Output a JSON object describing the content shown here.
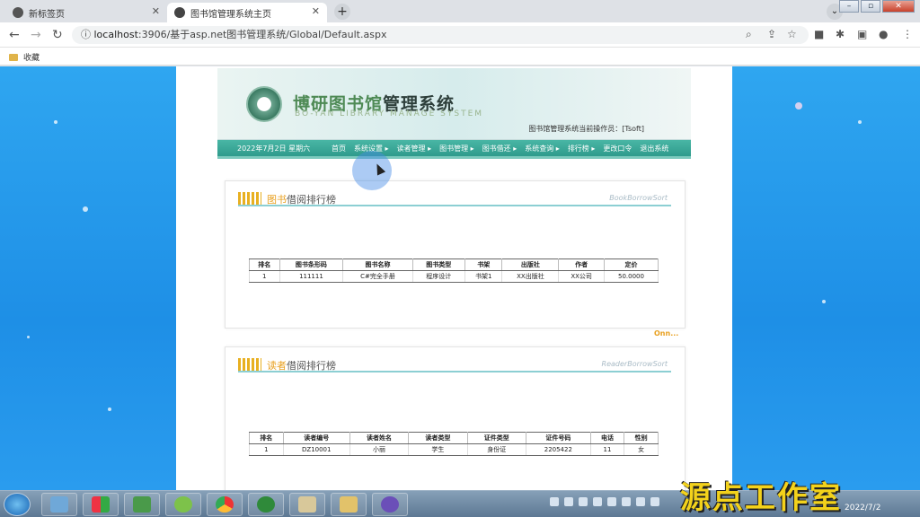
{
  "browser": {
    "tabs": [
      {
        "title": "新标签页",
        "active": false
      },
      {
        "title": "图书馆管理系统主页",
        "active": true
      }
    ],
    "new_tab": "+",
    "close": "✕",
    "url_prefix": "localhost",
    "url_rest": ":3906/基于asp.net图书管理系统/Global/Default.aspx",
    "bookmarks": [
      {
        "label": "收藏"
      }
    ]
  },
  "header": {
    "title_cn_highlight": "博研图书馆",
    "title_cn_rest": "管理系统",
    "subtitle_en": "BO-YAN LIBRARY  MANAGE SYSTEM",
    "welcome": "图书馆管理系统当前操作员：[Tsoft]"
  },
  "menu": {
    "date": "2022年7月2日  星期六",
    "items": [
      "首页",
      "系统设置 ▸",
      "读者管理 ▸",
      "图书管理 ▸",
      "图书借还 ▸",
      "系统查询 ▸",
      "排行榜 ▸",
      "更改口令",
      "退出系统"
    ]
  },
  "book_rank": {
    "title_highlight": "图书",
    "title_rest": "借阅排行榜",
    "english": "BookBorrowSort",
    "columns": [
      "排名",
      "图书条形码",
      "图书名称",
      "图书类型",
      "书架",
      "出版社",
      "作者",
      "定价"
    ],
    "rows": [
      [
        "1",
        "111111",
        "C#完全手册",
        "程序设计",
        "书架1",
        "XX出版社",
        "XX公司",
        "50.0000"
      ]
    ]
  },
  "reader_rank": {
    "title_highlight": "读者",
    "title_rest": "借阅排行榜",
    "english": "ReaderBorrowSort",
    "columns": [
      "排名",
      "读者编号",
      "读者姓名",
      "读者类型",
      "证件类型",
      "证件号码",
      "电话",
      "性别"
    ],
    "rows": [
      [
        "1",
        "DZ10001",
        "小丽",
        "学生",
        "身份证",
        "2205422",
        "11",
        "女"
      ]
    ]
  },
  "small_logo": "Onn...",
  "taskbar": {
    "clock_date": "2022/7/2"
  },
  "watermark": "源点工作室"
}
